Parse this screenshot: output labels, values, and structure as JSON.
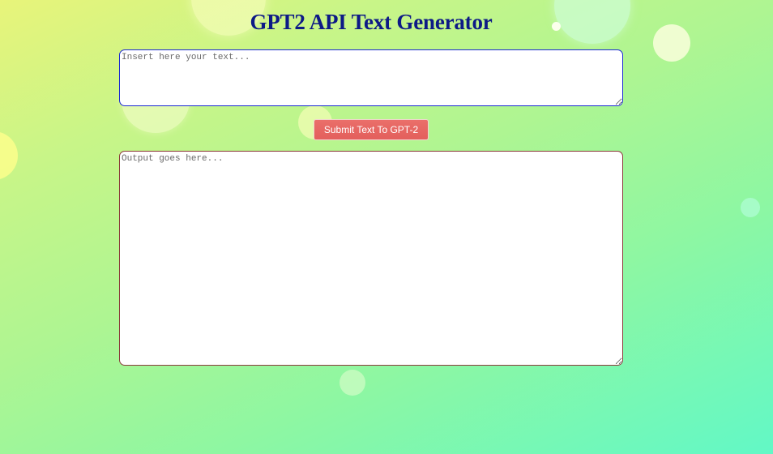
{
  "page": {
    "title": "GPT2 API Text Generator"
  },
  "input": {
    "placeholder": "Insert here your text...",
    "value": ""
  },
  "submit": {
    "label": "Submit Text To GPT-2"
  },
  "output": {
    "placeholder": "Output goes here...",
    "value": ""
  },
  "colors": {
    "title": "#0d1a86",
    "button": "#e3625e",
    "input_border": "#1c2ad2",
    "output_border": "#8a3a3a"
  }
}
